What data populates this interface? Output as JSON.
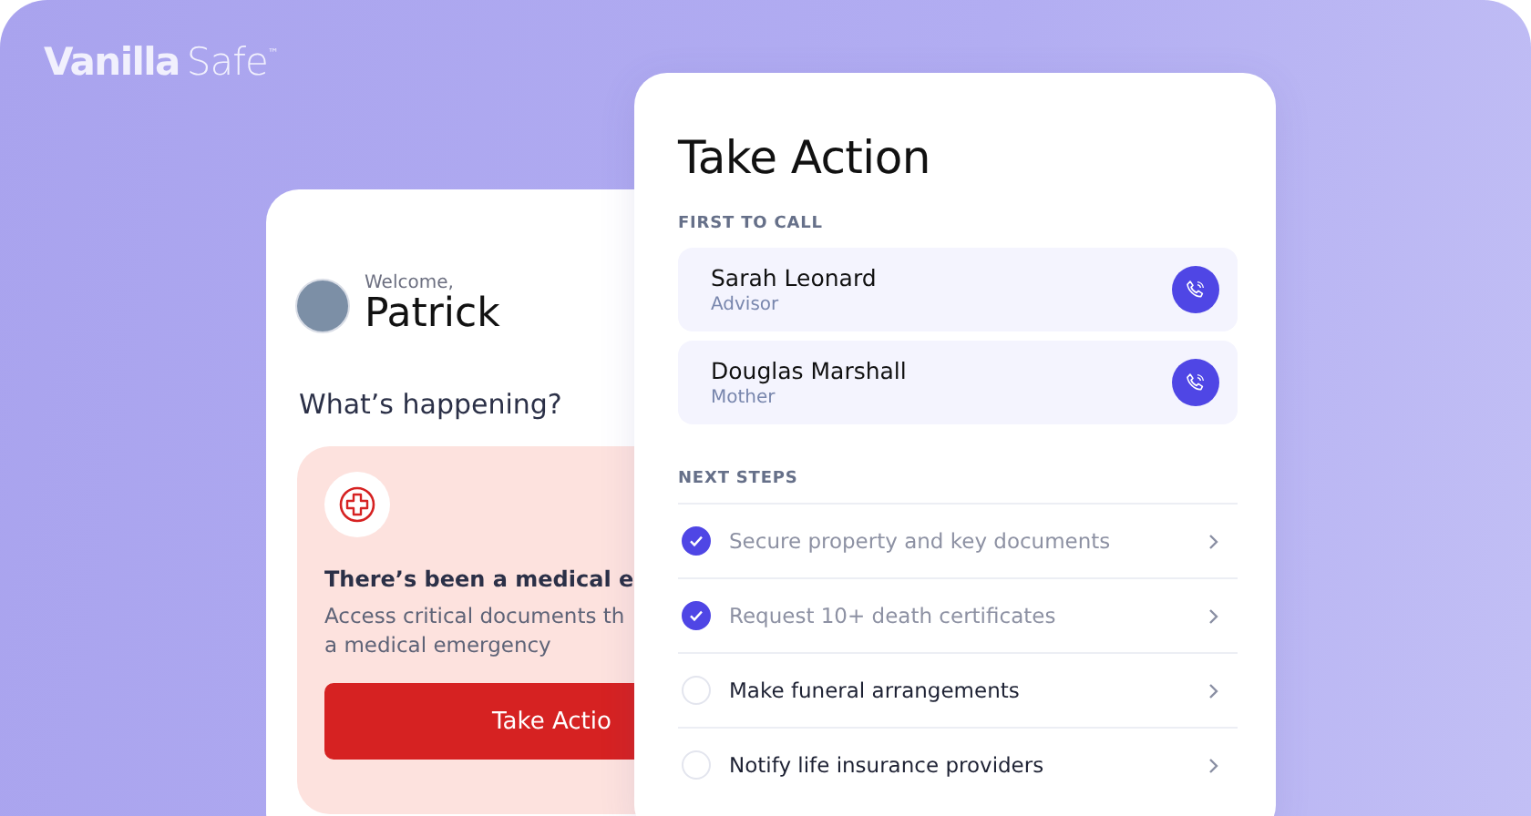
{
  "logo": {
    "primary": "Vanilla",
    "secondary": "Safe",
    "mark": "™"
  },
  "welcome_card": {
    "greeting": "Welcome,",
    "name": "Patrick",
    "question": "What’s happening?",
    "alert": {
      "title": "There’s been a medical e",
      "description": [
        "Access critical documents th",
        "a medical emergency"
      ],
      "button": "Take Actio"
    }
  },
  "action_panel": {
    "title": "Take Action",
    "first_to_call": {
      "heading": "FIRST TO CALL",
      "contacts": [
        {
          "name": "Sarah Leonard",
          "role": "Advisor"
        },
        {
          "name": "Douglas Marshall",
          "role": "Mother"
        }
      ]
    },
    "next_steps": {
      "heading": "NEXT STEPS",
      "items": [
        {
          "label": "Secure property and key documents",
          "checked": true
        },
        {
          "label": "Request 10+ death certificates",
          "checked": true
        },
        {
          "label": "Make funeral arrangements",
          "checked": false
        },
        {
          "label": "Notify life insurance providers",
          "checked": false
        }
      ]
    }
  }
}
